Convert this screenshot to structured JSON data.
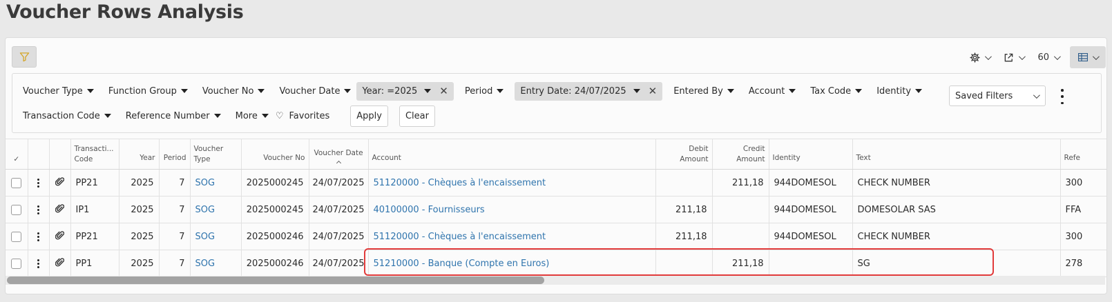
{
  "page_title": "Voucher Rows Analysis",
  "toolbar": {
    "page_size": "60"
  },
  "filters": {
    "row1": [
      "Voucher Type",
      "Function Group",
      "Voucher No",
      "Voucher Date"
    ],
    "chip_year": "Year: =2025",
    "period": "Period",
    "chip_entry_date": "Entry Date: 24/07/2025",
    "row1b": [
      "Entered By",
      "Account",
      "Tax Code",
      "Identity"
    ],
    "row2": [
      "Transaction Code",
      "Reference Number",
      "More"
    ],
    "favorites": "Favorites",
    "apply": "Apply",
    "clear": "Clear",
    "saved_filters": "Saved Filters"
  },
  "columns": {
    "check": "✓",
    "transaction_code_1": "Transacti...",
    "transaction_code_2": "Code",
    "year": "Year",
    "period": "Period",
    "voucher_type_1": "Voucher",
    "voucher_type_2": "Type",
    "voucher_no": "Voucher No",
    "voucher_date": "Voucher Date",
    "account": "Account",
    "debit_1": "Debit",
    "debit_2": "Amount",
    "credit_1": "Credit",
    "credit_2": "Amount",
    "identity": "Identity",
    "text": "Text",
    "reference": "Refe"
  },
  "rows": [
    {
      "code": "PP21",
      "year": "2025",
      "period": "7",
      "vtype": "SOG",
      "vno": "2025000245",
      "vdate": "24/07/2025",
      "account": "51120000 - Chèques à l'encaissement",
      "debit": "",
      "credit": "211,18",
      "identity": "944DOMESOL",
      "text": "CHECK NUMBER",
      "ref": "300"
    },
    {
      "code": "IP1",
      "year": "2025",
      "period": "7",
      "vtype": "SOG",
      "vno": "2025000245",
      "vdate": "24/07/2025",
      "account": "40100000 - Fournisseurs",
      "debit": "211,18",
      "credit": "",
      "identity": "944DOMESOL",
      "text": "DOMESOLAR SAS",
      "ref": "FFA"
    },
    {
      "code": "PP21",
      "year": "2025",
      "period": "7",
      "vtype": "SOG",
      "vno": "2025000246",
      "vdate": "24/07/2025",
      "account": "51120000 - Chèques à l'encaissement",
      "debit": "211,18",
      "credit": "",
      "identity": "944DOMESOL",
      "text": "CHECK NUMBER",
      "ref": "300"
    },
    {
      "code": "PP1",
      "year": "2025",
      "period": "7",
      "vtype": "SOG",
      "vno": "2025000246",
      "vdate": "24/07/2025",
      "account": "51210000 - Banque (Compte en Euros)",
      "debit": "",
      "credit": "211,18",
      "identity": "",
      "text": "SG",
      "ref": "278"
    }
  ],
  "colors": {
    "link": "#2f74ad",
    "highlight": "#e13a3a"
  }
}
